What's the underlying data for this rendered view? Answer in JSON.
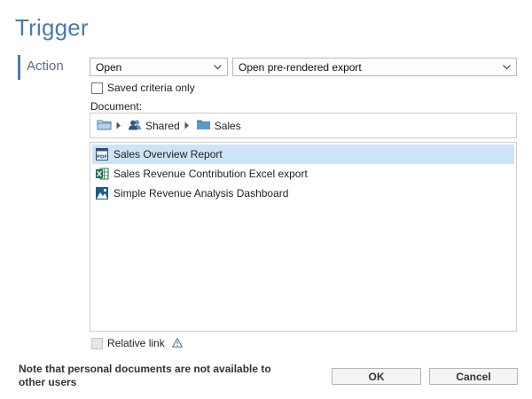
{
  "dialog": {
    "title": "Trigger",
    "section_label": "Action"
  },
  "action_select": {
    "value": "Open"
  },
  "mode_select": {
    "value": "Open pre-rendered export"
  },
  "saved_criteria": {
    "label": "Saved criteria only",
    "checked": false
  },
  "document_label": "Document:",
  "breadcrumb": {
    "items": [
      {
        "icon": "folder-root-icon"
      },
      {
        "label": "Shared",
        "icon": "shared-users-icon"
      },
      {
        "label": "Sales",
        "icon": "folder-icon"
      }
    ]
  },
  "documents": [
    {
      "label": "Sales Overview Report",
      "icon": "pdf-icon",
      "selected": true
    },
    {
      "label": "Sales Revenue Contribution Excel export",
      "icon": "excel-icon",
      "selected": false
    },
    {
      "label": "Simple Revenue Analysis Dashboard",
      "icon": "dashboard-icon",
      "selected": false
    }
  ],
  "relative_link": {
    "label": "Relative link",
    "checked": false,
    "disabled": true
  },
  "note": "Note that personal documents are not available to other users",
  "buttons": {
    "ok": "OK",
    "cancel": "Cancel"
  },
  "colors": {
    "accent": "#4a7ab5",
    "selection": "#cde3f7",
    "excel": "#1e7145",
    "folder": "#4a86c5"
  }
}
